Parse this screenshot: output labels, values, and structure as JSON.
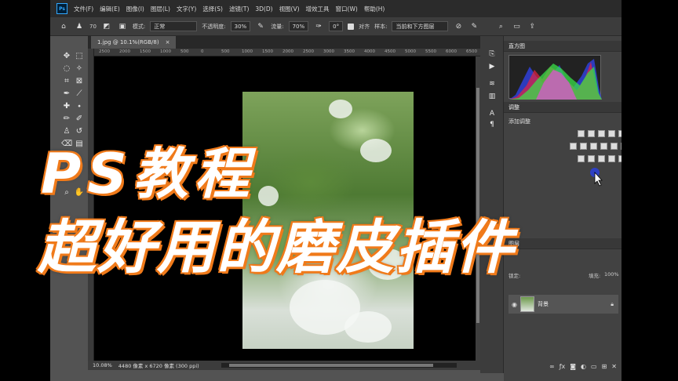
{
  "menubar": {
    "logo": "Ps",
    "items": [
      "文件(F)",
      "编辑(E)",
      "图像(I)",
      "图层(L)",
      "文字(Y)",
      "选择(S)",
      "滤镜(T)",
      "3D(D)",
      "视图(V)",
      "增效工具",
      "窗口(W)",
      "帮助(H)"
    ]
  },
  "options": {
    "brush_size": "70",
    "mode_label": "模式:",
    "mode_value": "正常",
    "opacity_label": "不透明度:",
    "opacity_value": "30%",
    "flow_label": "流量:",
    "flow_value": "70%",
    "angle_value": "0°",
    "align_label": "对齐",
    "sample_label": "样本:",
    "sample_value": "当前和下方图层"
  },
  "document": {
    "tab_title": "1.jpg @ 10.1%(RGB/8)",
    "close": "×",
    "ruler_ticks": [
      "2500",
      "2000",
      "1500",
      "1000",
      "500",
      "0",
      "500",
      "1000",
      "1500",
      "2000",
      "2500",
      "3000",
      "3500",
      "4000",
      "4500",
      "5000",
      "5500",
      "6000",
      "6500",
      "7000"
    ]
  },
  "status": {
    "zoom": "10.08%",
    "size": "4480 像素 x 6720 像素 (300 ppi)"
  },
  "panels": {
    "histogram_title": "直方图",
    "adjustments_title": "调整",
    "adjustments_label": "添加调整",
    "layers_title": "图层",
    "lock_label": "锁定:",
    "fill_label": "填充:",
    "fill_value": "100%",
    "layer_name": "背景"
  },
  "overlay": {
    "line1": "PS教程",
    "line2": "超好用的磨皮插件"
  },
  "colors": {
    "accent_orange": "#f07a1a",
    "ps_blue": "#31a8ff"
  }
}
